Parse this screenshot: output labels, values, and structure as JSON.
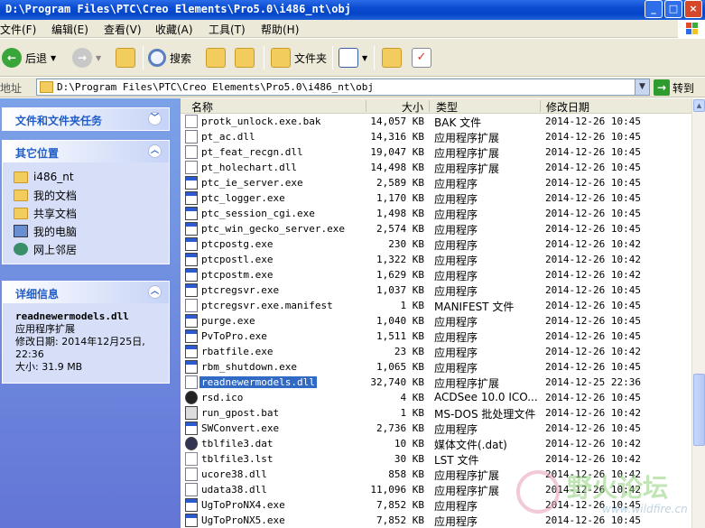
{
  "window": {
    "title": "D:\\Program Files\\PTC\\Creo Elements\\Pro5.0\\i486_nt\\obj",
    "min": "_",
    "max": "□",
    "close": "×"
  },
  "menu": [
    {
      "label": "文件(F)"
    },
    {
      "label": "编辑(E)"
    },
    {
      "label": "查看(V)"
    },
    {
      "label": "收藏(A)"
    },
    {
      "label": "工具(T)"
    },
    {
      "label": "帮助(H)"
    }
  ],
  "toolbar": {
    "back": "后退",
    "search": "搜索",
    "folders": "文件夹"
  },
  "address": {
    "label": "地址",
    "path": "D:\\Program Files\\PTC\\Creo Elements\\Pro5.0\\i486_nt\\obj",
    "go": "转到"
  },
  "sidebar": {
    "tasks_header": "文件和文件夹任务",
    "places_header": "其它位置",
    "places": [
      {
        "label": "i486_nt"
      },
      {
        "label": "我的文档"
      },
      {
        "label": "共享文档"
      },
      {
        "label": "我的电脑"
      },
      {
        "label": "网上邻居"
      }
    ],
    "details_header": "详细信息",
    "details": {
      "name": "readnewermodels.dll",
      "type": "应用程序扩展",
      "modified": "修改日期: 2014年12月25日, 22:36",
      "size": "大小: 31.9 MB"
    }
  },
  "columns": {
    "name": "名称",
    "size": "大小",
    "type": "类型",
    "date": "修改日期"
  },
  "files": [
    {
      "name": "protk_unlock.exe.bak",
      "size": "14,057 KB",
      "type": "BAK 文件",
      "date": "2014-12-26  10:45",
      "icon": "txt"
    },
    {
      "name": "pt_ac.dll",
      "size": "14,316 KB",
      "type": "应用程序扩展",
      "date": "2014-12-26  10:45",
      "icon": "dll"
    },
    {
      "name": "pt_feat_recgn.dll",
      "size": "19,047 KB",
      "type": "应用程序扩展",
      "date": "2014-12-26  10:45",
      "icon": "dll"
    },
    {
      "name": "pt_holechart.dll",
      "size": "14,498 KB",
      "type": "应用程序扩展",
      "date": "2014-12-26  10:45",
      "icon": "dll"
    },
    {
      "name": "ptc_ie_server.exe",
      "size": "2,589 KB",
      "type": "应用程序",
      "date": "2014-12-26  10:45",
      "icon": "exe"
    },
    {
      "name": "ptc_logger.exe",
      "size": "1,170 KB",
      "type": "应用程序",
      "date": "2014-12-26  10:45",
      "icon": "exe"
    },
    {
      "name": "ptc_session_cgi.exe",
      "size": "1,498 KB",
      "type": "应用程序",
      "date": "2014-12-26  10:45",
      "icon": "exe"
    },
    {
      "name": "ptc_win_gecko_server.exe",
      "size": "2,574 KB",
      "type": "应用程序",
      "date": "2014-12-26  10:45",
      "icon": "exe"
    },
    {
      "name": "ptcpostg.exe",
      "size": "230 KB",
      "type": "应用程序",
      "date": "2014-12-26  10:42",
      "icon": "exe"
    },
    {
      "name": "ptcpostl.exe",
      "size": "1,322 KB",
      "type": "应用程序",
      "date": "2014-12-26  10:42",
      "icon": "exe"
    },
    {
      "name": "ptcpostm.exe",
      "size": "1,629 KB",
      "type": "应用程序",
      "date": "2014-12-26  10:42",
      "icon": "exe"
    },
    {
      "name": "ptcregsvr.exe",
      "size": "1,037 KB",
      "type": "应用程序",
      "date": "2014-12-26  10:45",
      "icon": "exe"
    },
    {
      "name": "ptcregsvr.exe.manifest",
      "size": "1 KB",
      "type": "MANIFEST 文件",
      "date": "2014-12-26  10:45",
      "icon": "dll"
    },
    {
      "name": "purge.exe",
      "size": "1,040 KB",
      "type": "应用程序",
      "date": "2014-12-26  10:45",
      "icon": "exe"
    },
    {
      "name": "PvToPro.exe",
      "size": "1,511 KB",
      "type": "应用程序",
      "date": "2014-12-26  10:45",
      "icon": "exe"
    },
    {
      "name": "rbatfile.exe",
      "size": "23 KB",
      "type": "应用程序",
      "date": "2014-12-26  10:42",
      "icon": "exe"
    },
    {
      "name": "rbm_shutdown.exe",
      "size": "1,065 KB",
      "type": "应用程序",
      "date": "2014-12-26  10:45",
      "icon": "exe"
    },
    {
      "name": "readnewermodels.dll",
      "size": "32,740 KB",
      "type": "应用程序扩展",
      "date": "2014-12-25  22:36",
      "icon": "dll",
      "selected": true
    },
    {
      "name": "rsd.ico",
      "size": "4 KB",
      "type": "ACDSee 10.0 ICO...",
      "date": "2014-12-26  10:45",
      "icon": "ico"
    },
    {
      "name": "run_gpost.bat",
      "size": "1 KB",
      "type": "MS-DOS 批处理文件",
      "date": "2014-12-26  10:42",
      "icon": "bat"
    },
    {
      "name": "SWConvert.exe",
      "size": "2,736 KB",
      "type": "应用程序",
      "date": "2014-12-26  10:45",
      "icon": "exe"
    },
    {
      "name": "tblfile3.dat",
      "size": "10 KB",
      "type": "媒体文件(.dat)",
      "date": "2014-12-26  10:42",
      "icon": "dat"
    },
    {
      "name": "tblfile3.lst",
      "size": "30 KB",
      "type": "LST 文件",
      "date": "2014-12-26  10:42",
      "icon": "txt"
    },
    {
      "name": "ucore38.dll",
      "size": "858 KB",
      "type": "应用程序扩展",
      "date": "2014-12-26  10:42",
      "icon": "dll"
    },
    {
      "name": "udata38.dll",
      "size": "11,096 KB",
      "type": "应用程序扩展",
      "date": "2014-12-26  10:42",
      "icon": "dll"
    },
    {
      "name": "UgToProNX4.exe",
      "size": "7,852 KB",
      "type": "应用程序",
      "date": "2014-12-26  10:45",
      "icon": "exe"
    },
    {
      "name": "UgToProNX5.exe",
      "size": "7,852 KB",
      "type": "应用程序",
      "date": "2014-12-26  10:45",
      "icon": "exe"
    }
  ],
  "watermark": {
    "title": "野火论坛",
    "url": "www.wildfire.cn"
  }
}
